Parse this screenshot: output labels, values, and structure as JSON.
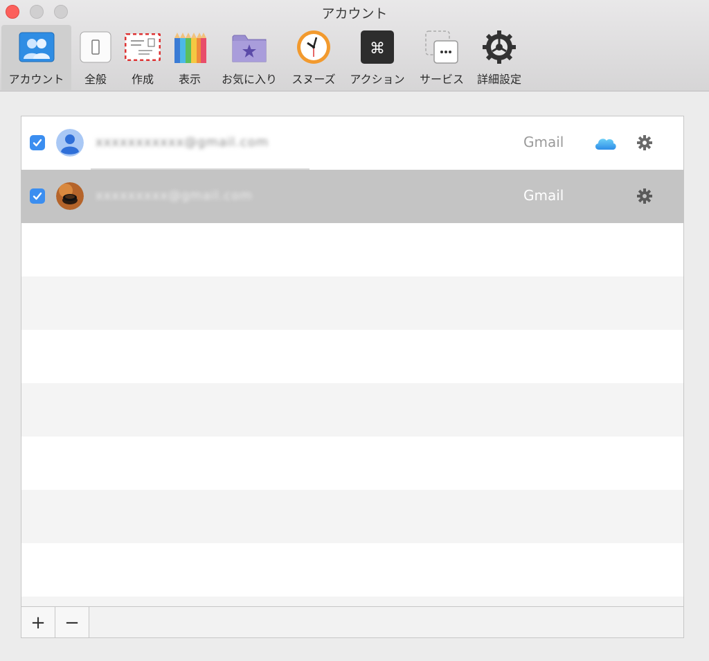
{
  "window": {
    "title": "アカウント"
  },
  "toolbar": {
    "items": [
      {
        "label": "アカウント",
        "icon": "accounts-icon",
        "active": true
      },
      {
        "label": "全般",
        "icon": "general-switch-icon",
        "active": false
      },
      {
        "label": "作成",
        "icon": "compose-envelope-icon",
        "active": false
      },
      {
        "label": "表示",
        "icon": "colored-pencils-icon",
        "active": false
      },
      {
        "label": "お気に入り",
        "icon": "favorites-star-folder-icon",
        "active": false
      },
      {
        "label": "スヌーズ",
        "icon": "snooze-clock-icon",
        "active": false
      },
      {
        "label": "アクション",
        "icon": "command-key-icon",
        "active": false
      },
      {
        "label": "サービス",
        "icon": "services-ellipsis-icon",
        "active": false
      },
      {
        "label": "詳細設定",
        "icon": "advanced-gear-icon",
        "active": false
      }
    ]
  },
  "accounts": [
    {
      "enabled": true,
      "email": "xxxxxxxxxxx@gmail.com",
      "type": "Gmail",
      "avatar": "default-person-avatar",
      "cloud_icon": "icloud-icon",
      "selected": false
    },
    {
      "enabled": true,
      "email": "xxxxxxxxx@gmail.com",
      "type": "Gmail",
      "avatar": "coffee-photo-avatar",
      "cloud_icon": null,
      "selected": true
    }
  ],
  "footer": {
    "add_label": "+",
    "remove_label": "−"
  },
  "colors": {
    "accent": "#3b8ef0",
    "selected_row": "#c4c4c4",
    "close_button": "#fc605c"
  }
}
